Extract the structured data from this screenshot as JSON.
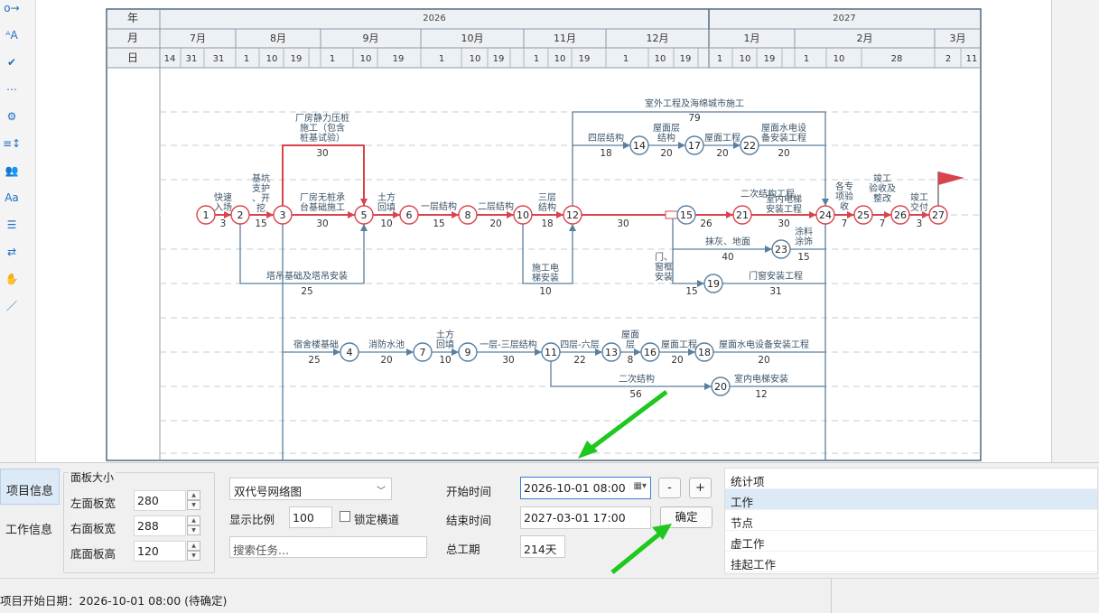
{
  "toolbar_icons": [
    "link-icon",
    "text-format-icon",
    "check-icon",
    "dots-icon",
    "gear-icon",
    "sort-icon",
    "users-icon",
    "font-size-icon",
    "filter-icon",
    "swap-icon",
    "hand-icon",
    "wand-icon"
  ],
  "header": {
    "row_labels": [
      "年",
      "月",
      "日"
    ],
    "years": [
      "2026",
      "2027"
    ],
    "months": [
      "7月",
      "8月",
      "9月",
      "10月",
      "11月",
      "12月",
      "1月",
      "2月",
      "3月"
    ],
    "days": [
      "14",
      "31",
      "31",
      "1",
      "10",
      "19",
      "1",
      "10",
      "19",
      "1",
      "10",
      "19",
      "1",
      "10",
      "19",
      "1",
      "10",
      "19",
      "1",
      "10",
      "19",
      "1",
      "10",
      "28",
      "2",
      "11"
    ]
  },
  "network": {
    "nodes": [
      "1",
      "2",
      "3",
      "4",
      "5",
      "6",
      "7",
      "8",
      "9",
      "10",
      "11",
      "12",
      "13",
      "14",
      "15",
      "16",
      "17",
      "18",
      "19",
      "20",
      "21",
      "22",
      "23",
      "24",
      "25",
      "26",
      "27"
    ],
    "activities": [
      {
        "name": "快速入场",
        "duration": "3"
      },
      {
        "name": "基坑支护、开挖",
        "duration": "15"
      },
      {
        "name": "厂房静力压桩施工（包含桩基试验）",
        "duration": "30"
      },
      {
        "name": "厂房无桩承台基础施工",
        "duration": "30"
      },
      {
        "name": "塔吊基础及塔吊安装",
        "duration": "25"
      },
      {
        "name": "土方回填",
        "duration": "10"
      },
      {
        "name": "一层结构",
        "duration": "15"
      },
      {
        "name": "二层结构",
        "duration": "20"
      },
      {
        "name": "三层结构",
        "duration": "18"
      },
      {
        "name": "施工电梯安装",
        "duration": "10"
      },
      {
        "name": "",
        "duration": "30"
      },
      {
        "name": "",
        "duration": "26"
      },
      {
        "name": "室外工程及海绵城市施工",
        "duration": "79"
      },
      {
        "name": "四层结构",
        "duration": "18"
      },
      {
        "name": "屋面层结构",
        "duration": "20"
      },
      {
        "name": "屋面工程",
        "duration": "20"
      },
      {
        "name": "屋面水电设备安装工程",
        "duration": "20"
      },
      {
        "name": "二次结构工程",
        "duration": ""
      },
      {
        "name": "室内电梯安装",
        "duration": "30"
      },
      {
        "name": "抹灰、地面",
        "duration": "40"
      },
      {
        "name": "涂料涂饰",
        "duration": "15"
      },
      {
        "name": "门、窗框安装",
        "duration": "15"
      },
      {
        "name": "门窗安装工程",
        "duration": "31"
      },
      {
        "name": "各专项验收",
        "duration": "7"
      },
      {
        "name": "竣工验收及整改",
        "duration": "7"
      },
      {
        "name": "竣工交付",
        "duration": "3"
      },
      {
        "name": "宿舍楼基础",
        "duration": "25"
      },
      {
        "name": "消防水池",
        "duration": "20"
      },
      {
        "name": "土方回填",
        "duration": "10"
      },
      {
        "name": "一层-三层结构",
        "duration": "30"
      },
      {
        "name": "四层-六层",
        "duration": "22"
      },
      {
        "name": "屋面层",
        "duration": "8"
      },
      {
        "name": "屋面工程",
        "duration": "20"
      },
      {
        "name": "屋面水电设备安装工程",
        "duration": "20"
      },
      {
        "name": "二次结构",
        "duration": "56"
      },
      {
        "name": "室内电梯安装",
        "duration": "12"
      }
    ]
  },
  "nav": {
    "project_info": "项目信息",
    "work_info": "工作信息"
  },
  "panel_size": {
    "title": "面板大小",
    "left_width_label": "左面板宽",
    "left_width": "280",
    "right_width_label": "右面板宽",
    "right_width": "288",
    "bottom_height_label": "底面板高",
    "bottom_height": "120"
  },
  "chart_options": {
    "type": "双代号网络图",
    "scale_label": "显示比例",
    "scale": "100",
    "lock_label": "锁定横道",
    "search_placeholder": "搜索任务..."
  },
  "time": {
    "start_label": "开始时间",
    "start_value": "2026-10-01 08:00",
    "end_label": "结束时间",
    "end_value": "2027-03-01 17:00",
    "total_label": "总工期",
    "total_value": "214天",
    "minus": "-",
    "plus": "+",
    "confirm": "确定"
  },
  "stats": {
    "items": [
      "统计项",
      "工作",
      "节点",
      "虚工作",
      "挂起工作"
    ],
    "selected": 1
  },
  "status": {
    "text": "项目开始日期：2026-10-01 08:00  (待确定)"
  },
  "colors": {
    "critical": "#d9434d",
    "normal": "#5a7f9e",
    "arrow": "#1ec81e",
    "accent": "#1f6fc4"
  }
}
